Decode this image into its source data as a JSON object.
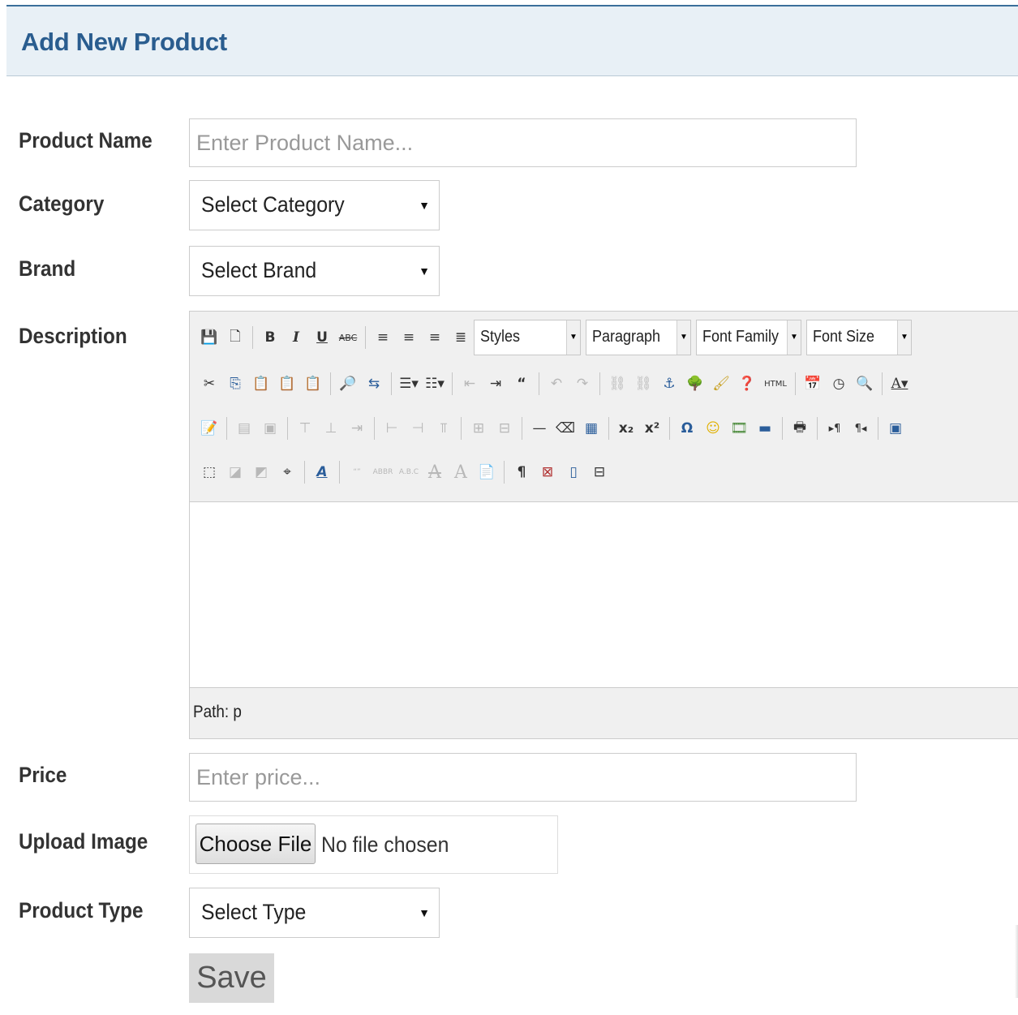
{
  "header": {
    "title": "Add New Product"
  },
  "form": {
    "product_name": {
      "label": "Product Name",
      "placeholder": "Enter Product Name..."
    },
    "category": {
      "label": "Category",
      "value": "Select Category"
    },
    "brand": {
      "label": "Brand",
      "value": "Select Brand"
    },
    "description": {
      "label": "Description",
      "toolbar": {
        "styles": "Styles",
        "paragraph": "Paragraph",
        "font_family": "Font Family",
        "font_size": "Font Size",
        "html_label": "HTML"
      },
      "path_label": "Path: p"
    },
    "price": {
      "label": "Price",
      "placeholder": "Enter price..."
    },
    "upload_image": {
      "label": "Upload Image",
      "button": "Choose File",
      "status": "No file chosen"
    },
    "product_type": {
      "label": "Product Type",
      "value": "Select Type"
    },
    "save_label": "Save"
  },
  "colors": {
    "header_bg": "#e8f0f6",
    "header_title": "#2a5d8f",
    "save_bg": "#d9d9d9"
  }
}
